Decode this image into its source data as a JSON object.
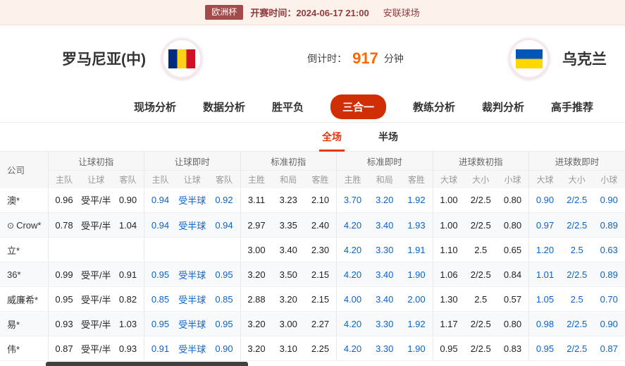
{
  "top_bar": {
    "league_badge": "欧洲杯",
    "kickoff_label": "开赛时间：2024-06-17 21:00",
    "venue": "安联球场"
  },
  "match": {
    "home_team": "罗马尼亚(中)",
    "away_team": "乌克兰",
    "countdown_label": "倒计时：",
    "countdown_value": "917",
    "countdown_unit": "分钟"
  },
  "nav_tabs": [
    {
      "label": "现场分析",
      "active": false
    },
    {
      "label": "数据分析",
      "active": false
    },
    {
      "label": "胜平负",
      "active": false
    },
    {
      "label": "三合一",
      "active": true
    },
    {
      "label": "教练分析",
      "active": false
    },
    {
      "label": "裁判分析",
      "active": false
    },
    {
      "label": "高手推荐",
      "active": false
    }
  ],
  "sub_tabs": [
    {
      "label": "全场",
      "active": true
    },
    {
      "label": "半场",
      "active": false
    }
  ],
  "table": {
    "company_header": "公司",
    "groups": [
      {
        "label": "让球初指",
        "cols": [
          "主队",
          "让球",
          "客队"
        ],
        "live": false
      },
      {
        "label": "让球即时",
        "cols": [
          "主队",
          "让球",
          "客队"
        ],
        "live": true
      },
      {
        "label": "标准初指",
        "cols": [
          "主胜",
          "和局",
          "客胜"
        ],
        "live": false
      },
      {
        "label": "标准即时",
        "cols": [
          "主胜",
          "和局",
          "客胜"
        ],
        "live": true
      },
      {
        "label": "进球数初指",
        "cols": [
          "大球",
          "大小",
          "小球"
        ],
        "live": false
      },
      {
        "label": "进球数即时",
        "cols": [
          "大球",
          "大小",
          "小球"
        ],
        "live": true
      }
    ],
    "rows": [
      {
        "company": "澳*",
        "icon": false,
        "cells": [
          "0.96",
          "受平/半",
          "0.90",
          "0.94",
          "受半球",
          "0.92",
          "3.11",
          "3.23",
          "2.10",
          "3.70",
          "3.20",
          "1.92",
          "1.00",
          "2/2.5",
          "0.80",
          "0.90",
          "2/2.5",
          "0.90"
        ]
      },
      {
        "company": "Crow*",
        "icon": true,
        "cells": [
          "0.78",
          "受平/半",
          "1.04",
          "0.94",
          "受半球",
          "0.94",
          "2.97",
          "3.35",
          "2.40",
          "4.20",
          "3.40",
          "1.93",
          "1.00",
          "2/2.5",
          "0.80",
          "0.97",
          "2/2.5",
          "0.89"
        ]
      },
      {
        "company": "立*",
        "icon": false,
        "cells": [
          "",
          "",
          "",
          "",
          "",
          "",
          "3.00",
          "3.40",
          "2.30",
          "4.20",
          "3.30",
          "1.91",
          "1.10",
          "2.5",
          "0.65",
          "1.20",
          "2.5",
          "0.63"
        ]
      },
      {
        "company": "36*",
        "icon": false,
        "cells": [
          "0.99",
          "受平/半",
          "0.91",
          "0.95",
          "受半球",
          "0.95",
          "3.20",
          "3.50",
          "2.15",
          "4.20",
          "3.40",
          "1.90",
          "1.06",
          "2/2.5",
          "0.84",
          "1.01",
          "2/2.5",
          "0.89"
        ]
      },
      {
        "company": "威廉希*",
        "icon": false,
        "cells": [
          "0.95",
          "受平/半",
          "0.82",
          "0.85",
          "受半球",
          "0.85",
          "2.88",
          "3.20",
          "2.15",
          "4.00",
          "3.40",
          "2.00",
          "1.30",
          "2.5",
          "0.57",
          "1.05",
          "2.5",
          "0.70"
        ]
      },
      {
        "company": "易*",
        "icon": false,
        "cells": [
          "0.93",
          "受平/半",
          "1.03",
          "0.95",
          "受半球",
          "0.95",
          "3.20",
          "3.00",
          "2.27",
          "4.20",
          "3.30",
          "1.92",
          "1.17",
          "2/2.5",
          "0.80",
          "0.98",
          "2/2.5",
          "0.90"
        ]
      },
      {
        "company": "伟*",
        "icon": false,
        "cells": [
          "0.87",
          "受平/半",
          "0.93",
          "0.91",
          "受半球",
          "0.90",
          "3.20",
          "3.10",
          "2.25",
          "4.20",
          "3.30",
          "1.90",
          "0.95",
          "2/2.5",
          "0.83",
          "0.95",
          "2/2.5",
          "0.87"
        ]
      }
    ]
  },
  "colors": {
    "topbar_bg": "#fdf1ec",
    "badge_bg": "#a34a4a",
    "topbar_text": "#8f3c3c",
    "active_tab_red": "#d02f06",
    "sub_tab_red": "#e8380d",
    "countdown_orange": "#ff6600",
    "live_odds_blue": "#0d62c9"
  }
}
